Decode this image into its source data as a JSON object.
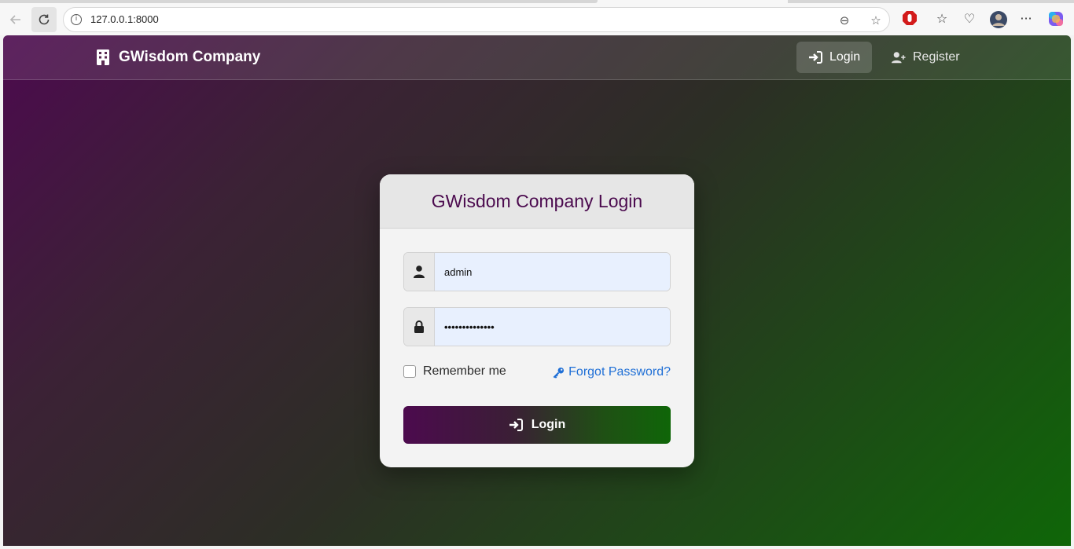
{
  "browser": {
    "url": "127.0.0.1:8000"
  },
  "navbar": {
    "brand": "GWisdom Company",
    "login_label": "Login",
    "register_label": "Register"
  },
  "login_card": {
    "title": "GWisdom Company Login",
    "username_value": "admin",
    "password_value": "••••••••••••••",
    "remember_label": "Remember me",
    "forgot_label": "Forgot Password?",
    "submit_label": "Login"
  },
  "colors": {
    "brand_purple": "#4b0a4e",
    "brand_green": "#0f6608",
    "link_blue": "#1f6fd6"
  }
}
